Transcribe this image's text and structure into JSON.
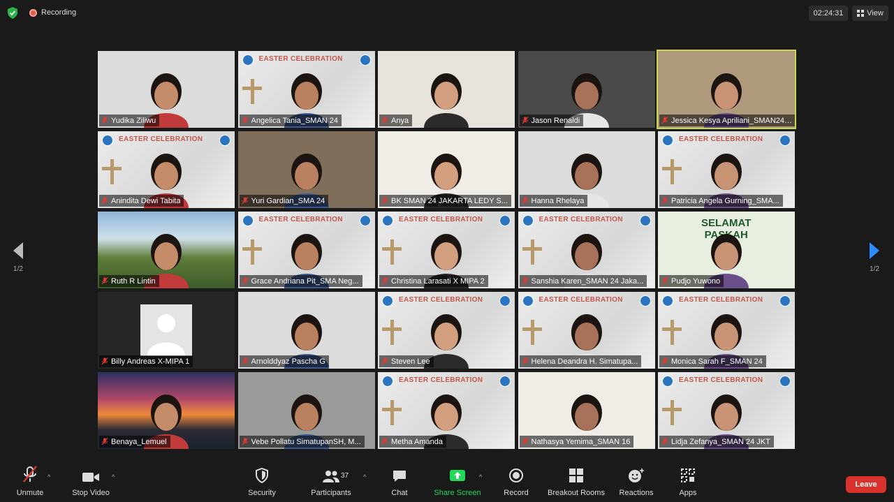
{
  "top": {
    "recording_label": "Recording",
    "timer": "02:24:31",
    "view_label": "View"
  },
  "pager": {
    "left": "1/2",
    "right": "1/2"
  },
  "colors": {
    "active_speaker": "#c7d94d",
    "leave": "#d9322c",
    "share_green": "#23d959"
  },
  "participants": [
    {
      "name": "Yudika Ziliwu",
      "bg": "photo"
    },
    {
      "name": "Angelica Tania_SMAN 24",
      "bg": "easter"
    },
    {
      "name": "Anya",
      "bg": "photo"
    },
    {
      "name": "Jason Renaldi",
      "bg": "photo"
    },
    {
      "name": "Jessica Kesya Apriliani_SMAN24J...",
      "bg": "photo",
      "active": true
    },
    {
      "name": "Anindita Dewi Tabita",
      "bg": "easter"
    },
    {
      "name": "Yuri Gardian_SMA 24",
      "bg": "photo"
    },
    {
      "name": "BK SMAN 24 JAKARTA LEDY S...",
      "bg": "photo"
    },
    {
      "name": "Hanna Rhelaya",
      "bg": "photo"
    },
    {
      "name": "Patricia Angela Gurning_SMA...",
      "bg": "easter"
    },
    {
      "name": "Ruth R Lintin",
      "bg": "landscape"
    },
    {
      "name": "Grace Andriana Pit_SMA Neg...",
      "bg": "easter"
    },
    {
      "name": "Christina Larasati X MIPA 2",
      "bg": "easter"
    },
    {
      "name": "Sanshia Karen_SMAN 24 Jaka...",
      "bg": "easter"
    },
    {
      "name": "Pudjo Yuwono",
      "bg": "paskah"
    },
    {
      "name": "Billy Andreas X-MIPA 1",
      "bg": "avatar"
    },
    {
      "name": "Arnolddyaz Pascha G",
      "bg": "photo"
    },
    {
      "name": "Steven Lee",
      "bg": "easter"
    },
    {
      "name": "Helena Deandra H. Simatupa...",
      "bg": "easter"
    },
    {
      "name": "Monica Sarah F_SMAN 24",
      "bg": "easter"
    },
    {
      "name": "Benaya_Lemuel",
      "bg": "sunset"
    },
    {
      "name": "Vebe Pollatu SimatupanSH, M...",
      "bg": "photo"
    },
    {
      "name": "Metha Amanda",
      "bg": "easter"
    },
    {
      "name": "Nathasya Yemima_SMAN 16",
      "bg": "photo"
    },
    {
      "name": "Lidja Zefanya_SMAN 24 JKT",
      "bg": "easter"
    }
  ],
  "banner": {
    "title": "EASTER CELEBRATION",
    "paskah_line1": "SELAMAT",
    "paskah_line2": "PASKAH"
  },
  "toolbar": {
    "unmute": "Unmute",
    "stop_video": "Stop Video",
    "security": "Security",
    "participants": "Participants",
    "participants_count": "37",
    "chat": "Chat",
    "share_screen": "Share Screen",
    "record": "Record",
    "breakout_rooms": "Breakout Rooms",
    "reactions": "Reactions",
    "apps": "Apps",
    "leave": "Leave"
  }
}
